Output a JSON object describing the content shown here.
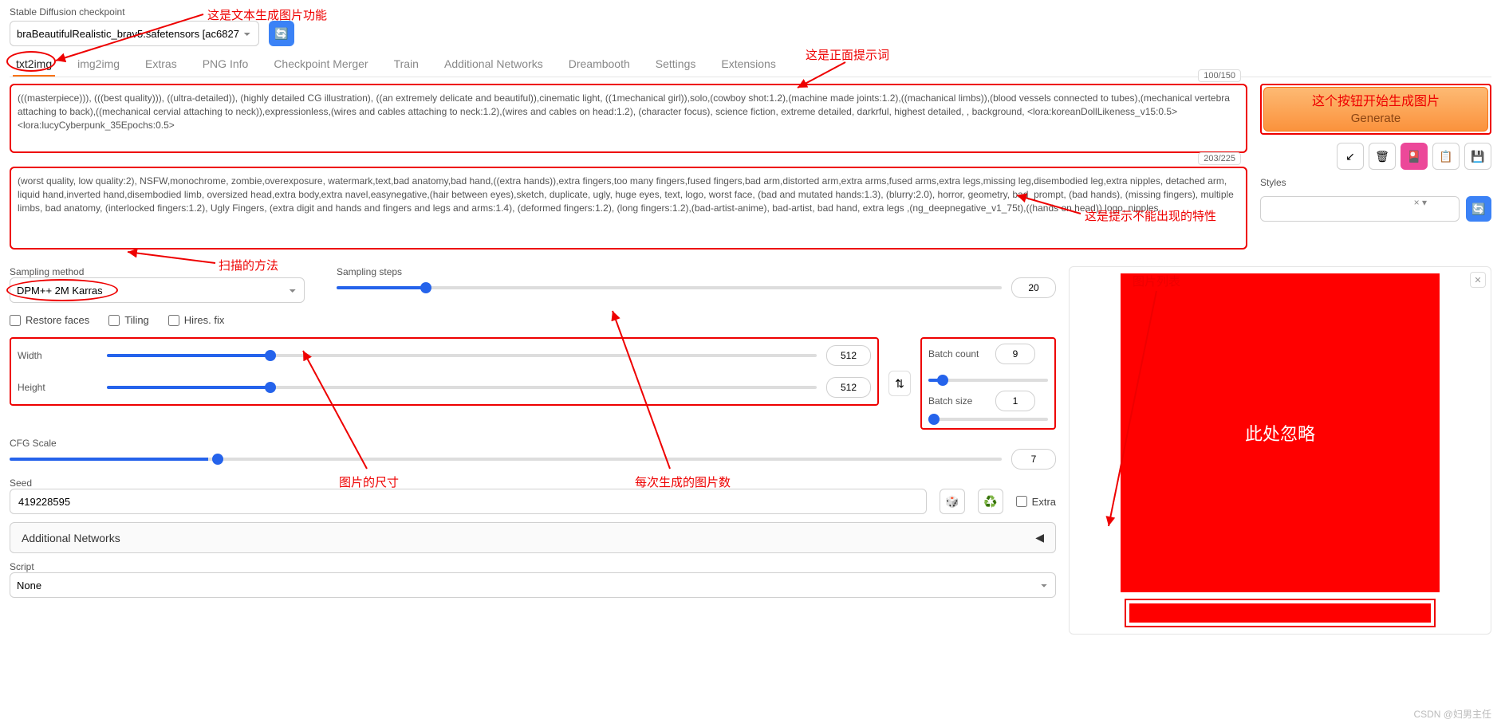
{
  "checkpoint": {
    "label": "Stable Diffusion checkpoint",
    "value": "braBeautifulRealistic_brav5.safetensors [ac6827"
  },
  "tabs": [
    "txt2img",
    "img2img",
    "Extras",
    "PNG Info",
    "Checkpoint Merger",
    "Train",
    "Additional Networks",
    "Dreambooth",
    "Settings",
    "Extensions"
  ],
  "active_tab": 0,
  "prompt": {
    "counter": "100/150",
    "value": "(((masterpiece))), (((best quality))), ((ultra-detailed)), (highly detailed CG illustration), ((an extremely delicate and beautiful)),cinematic light, ((1mechanical girl)),solo,(cowboy shot:1.2),(machine made joints:1.2),((machanical limbs)),(blood vessels connected to tubes),(mechanical vertebra attaching to back),((mechanical cervial attaching to neck)),expressionless,(wires and cables attaching to neck:1.2),(wires and cables on head:1.2), (character focus), science fiction, extreme detailed, darkrful, highest detailed, , background, <lora:koreanDollLikeness_v15:0.5> <lora:lucyCyberpunk_35Epochs:0.5>"
  },
  "neg_prompt": {
    "counter": "203/225",
    "value": "(worst quality, low quality:2), NSFW,monochrome, zombie,overexposure, watermark,text,bad anatomy,bad hand,((extra hands)),extra fingers,too many fingers,fused fingers,bad arm,distorted arm,extra arms,fused arms,extra legs,missing leg,disembodied leg,extra nipples, detached arm, liquid hand,inverted hand,disembodied limb, oversized head,extra body,extra navel,easynegative,(hair between eyes),sketch, duplicate, ugly, huge eyes, text, logo, worst face, (bad and mutated hands:1.3), (blurry:2.0), horror, geometry, bad_prompt, (bad hands), (missing fingers), multiple limbs, bad anatomy, (interlocked fingers:1.2), Ugly Fingers, (extra digit and hands and fingers and legs and arms:1.4), (deformed fingers:1.2), (long fingers:1.2),(bad-artist-anime), bad-artist, bad hand, extra legs ,(ng_deepnegative_v1_75t),((hands on head)) logo, nipples,"
  },
  "generate": {
    "label": "Generate"
  },
  "styles": {
    "label": "Styles",
    "value": "× ▾"
  },
  "sampling": {
    "method_label": "Sampling method",
    "method_value": "DPM++ 2M Karras",
    "steps_label": "Sampling steps",
    "steps_value": "20"
  },
  "checks": {
    "restore": "Restore faces",
    "tiling": "Tiling",
    "hires": "Hires. fix"
  },
  "dims": {
    "width_label": "Width",
    "width_value": "512",
    "height_label": "Height",
    "height_value": "512"
  },
  "batch": {
    "count_label": "Batch count",
    "count_value": "9",
    "size_label": "Batch size",
    "size_value": "1"
  },
  "cfg": {
    "label": "CFG Scale",
    "value": "7"
  },
  "seed": {
    "label": "Seed",
    "value": "419228595",
    "extra": "Extra"
  },
  "accordion": {
    "label": "Additional Networks"
  },
  "script": {
    "label": "Script",
    "value": "None"
  },
  "output": {
    "placeholder": "此处忽略"
  },
  "annotations": {
    "a1": "这是文本生成图片功能",
    "a2": "这是正面提示词",
    "a3": "这个按钮开始生成图片",
    "a4": "这是提示不能出现的特性",
    "a5": "扫描的方法",
    "a6": "图片的尺寸",
    "a7": "每次生成的图片数",
    "a8": "图片列表"
  },
  "watermark": "CSDN @妇男主任"
}
